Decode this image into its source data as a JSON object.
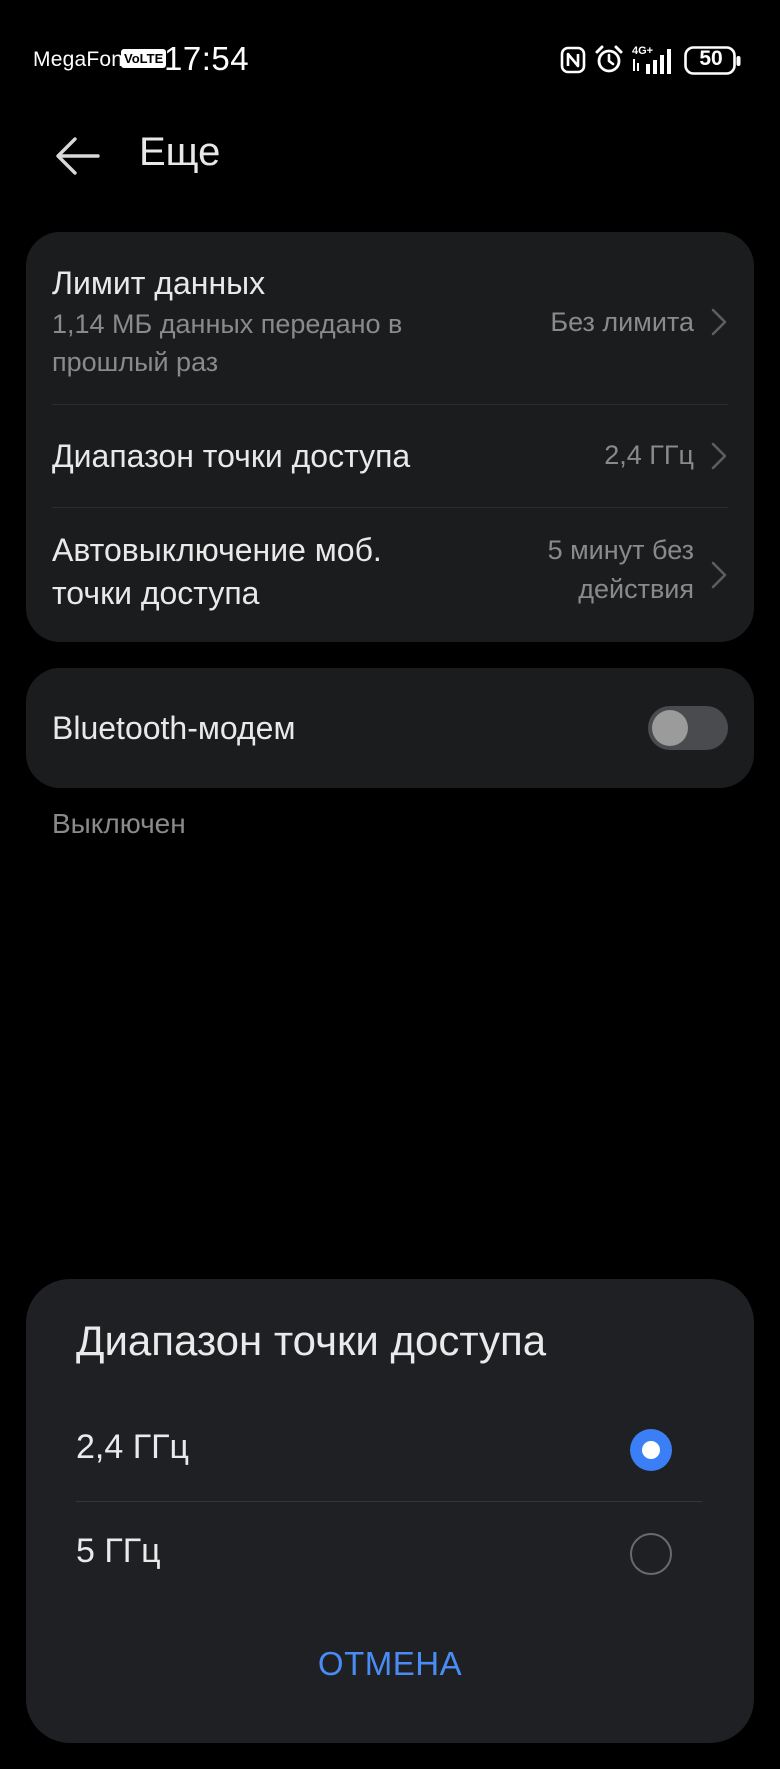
{
  "status_bar": {
    "carrier": "MegaFon",
    "volte": "VoLTE",
    "time": "17:54",
    "network": "4G+",
    "battery": "50",
    "icons": [
      "nfc-icon",
      "alarm-icon",
      "signal-icon",
      "battery-icon"
    ]
  },
  "header": {
    "back_icon": "arrow-left-icon",
    "title": "Еще"
  },
  "settings": [
    {
      "title": "Лимит данных",
      "subtitle_line1": "1,14 МБ данных передано в",
      "subtitle_line2": "прошлый раз",
      "value": "Без лимита"
    },
    {
      "title": "Диапазон точки доступа",
      "value": "2,4 ГГц"
    },
    {
      "title_line1": "Автовыключение моб.",
      "title_line2": "точки доступа",
      "value_line1": "5 минут без",
      "value_line2": "действия"
    }
  ],
  "bluetooth": {
    "title": "Bluetooth-модем",
    "enabled": false,
    "status": "Выключен"
  },
  "dialog": {
    "title": "Диапазон точки доступа",
    "options": [
      {
        "label": "2,4 ГГц",
        "selected": true
      },
      {
        "label": "5 ГГц",
        "selected": false
      }
    ],
    "cancel_label": "ОТМЕНА"
  },
  "colors": {
    "accent": "#3a7ff5",
    "card_background": "#1b1c1e",
    "sheet_background": "#1f2023"
  }
}
